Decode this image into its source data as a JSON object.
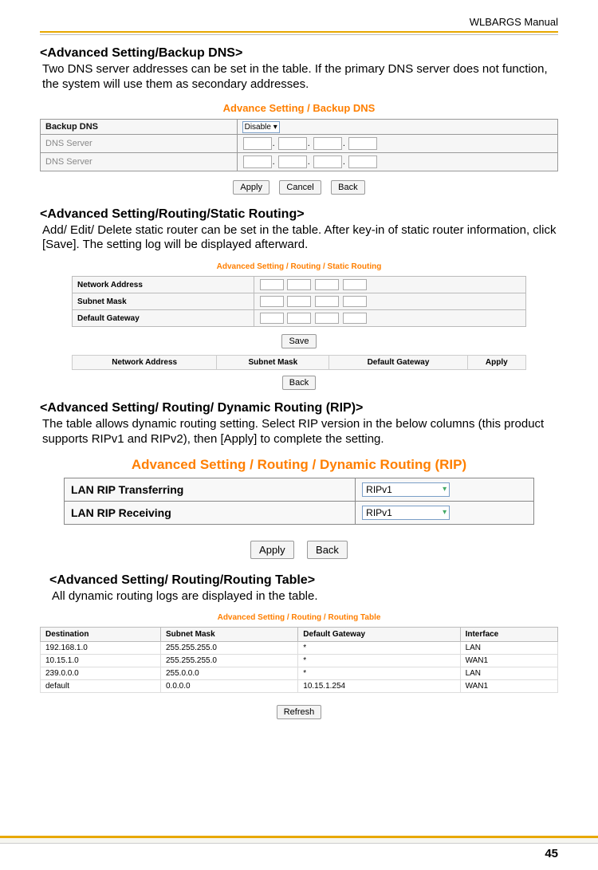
{
  "header": {
    "manual": "WLBARGS Manual"
  },
  "sections": {
    "s1": {
      "heading": "<Advanced Setting/Backup DNS>",
      "body": "Two DNS server addresses can be set in the table.  If the primary DNS server does not function, the system will use them as secondary addresses.",
      "screenshot": {
        "title": "Advance Setting / Backup DNS",
        "rows": {
          "r0": "Backup DNS",
          "r0v": "Disable",
          "r1": "DNS Server",
          "r2": "DNS Server"
        },
        "buttons": {
          "apply": "Apply",
          "cancel": "Cancel",
          "back": "Back"
        }
      }
    },
    "s2": {
      "heading": "<Advanced Setting/Routing/Static Routing>",
      "body": "Add/ Edit/ Delete static router can be set in the table.  After key-in of static router information, click [Save].  The setting log will be displayed afterward.",
      "screenshot": {
        "title": "Advanced Setting / Routing / Static Routing",
        "rows": {
          "r0": "Network Address",
          "r1": "Subnet Mask",
          "r2": "Default Gateway"
        },
        "save": "Save",
        "cols": {
          "c0": "Network Address",
          "c1": "Subnet Mask",
          "c2": "Default Gateway",
          "c3": "Apply"
        },
        "back": "Back"
      }
    },
    "s3": {
      "heading": "<Advanced Setting/ Routing/ Dynamic Routing (RIP)>",
      "body": "The table allows dynamic routing setting.  Select RIP version in the below columns (this product supports RIPv1 and RIPv2), then [Apply] to complete the setting.",
      "screenshot": {
        "title": "Advanced Setting / Routing / Dynamic Routing (RIP)",
        "rows": {
          "r0": "LAN RIP Transferring",
          "r0v": "RIPv1",
          "r1": "LAN RIP Receiving",
          "r1v": "RIPv1"
        },
        "buttons": {
          "apply": "Apply",
          "back": "Back"
        }
      }
    },
    "s4": {
      "heading": "<Advanced Setting/ Routing/Routing Table>",
      "body": "All dynamic routing logs are displayed in the table.",
      "screenshot": {
        "title": "Advanced Setting / Routing / Routing Table",
        "headers": {
          "h0": "Destination",
          "h1": "Subnet Mask",
          "h2": "Default Gateway",
          "h3": "Interface"
        },
        "rows": {
          "r0": {
            "c0": "192.168.1.0",
            "c1": "255.255.255.0",
            "c2": "*",
            "c3": "LAN"
          },
          "r1": {
            "c0": "10.15.1.0",
            "c1": "255.255.255.0",
            "c2": "*",
            "c3": "WAN1"
          },
          "r2": {
            "c0": "239.0.0.0",
            "c1": "255.0.0.0",
            "c2": "*",
            "c3": "LAN"
          },
          "r3": {
            "c0": "default",
            "c1": "0.0.0.0",
            "c2": "10.15.1.254",
            "c3": "WAN1"
          }
        },
        "refresh": "Refresh"
      }
    }
  },
  "page_number": "45"
}
